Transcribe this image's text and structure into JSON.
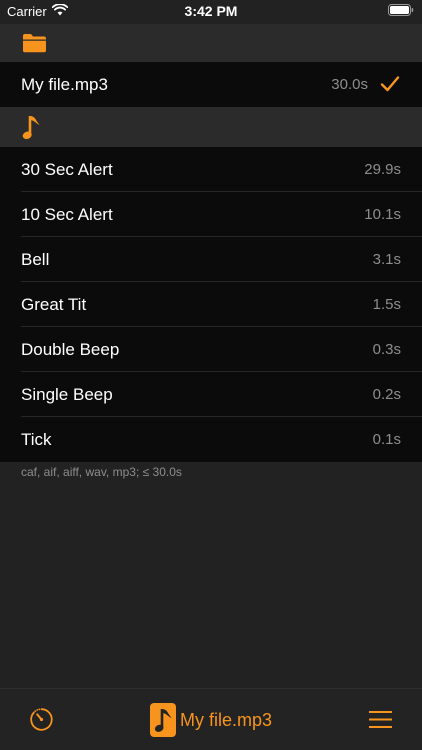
{
  "status_bar": {
    "carrier": "Carrier",
    "time": "3:42 PM"
  },
  "colors": {
    "accent": "#f7941d",
    "background": "#222222",
    "row_background": "#0b0b0b",
    "secondary_text": "#8d8d8d"
  },
  "custom_section": {
    "icon": "folder-icon",
    "items": [
      {
        "label": "My file.mp3",
        "duration": "30.0s",
        "selected": true
      }
    ]
  },
  "builtin_section": {
    "icon": "music-note-icon",
    "items": [
      {
        "label": "30 Sec Alert",
        "duration": "29.9s"
      },
      {
        "label": "10 Sec Alert",
        "duration": "10.1s"
      },
      {
        "label": "Bell",
        "duration": "3.1s"
      },
      {
        "label": "Great Tit",
        "duration": "1.5s"
      },
      {
        "label": "Double Beep",
        "duration": "0.3s"
      },
      {
        "label": "Single Beep",
        "duration": "0.2s"
      },
      {
        "label": "Tick",
        "duration": "0.1s"
      }
    ]
  },
  "footer_note": "caf, aif, aiff, wav, mp3; ≤ 30.0s",
  "toolbar": {
    "left_icon": "timer-icon",
    "current_sound": "My file.mp3",
    "center_icon": "music-note-icon",
    "right_icon": "menu-icon"
  }
}
